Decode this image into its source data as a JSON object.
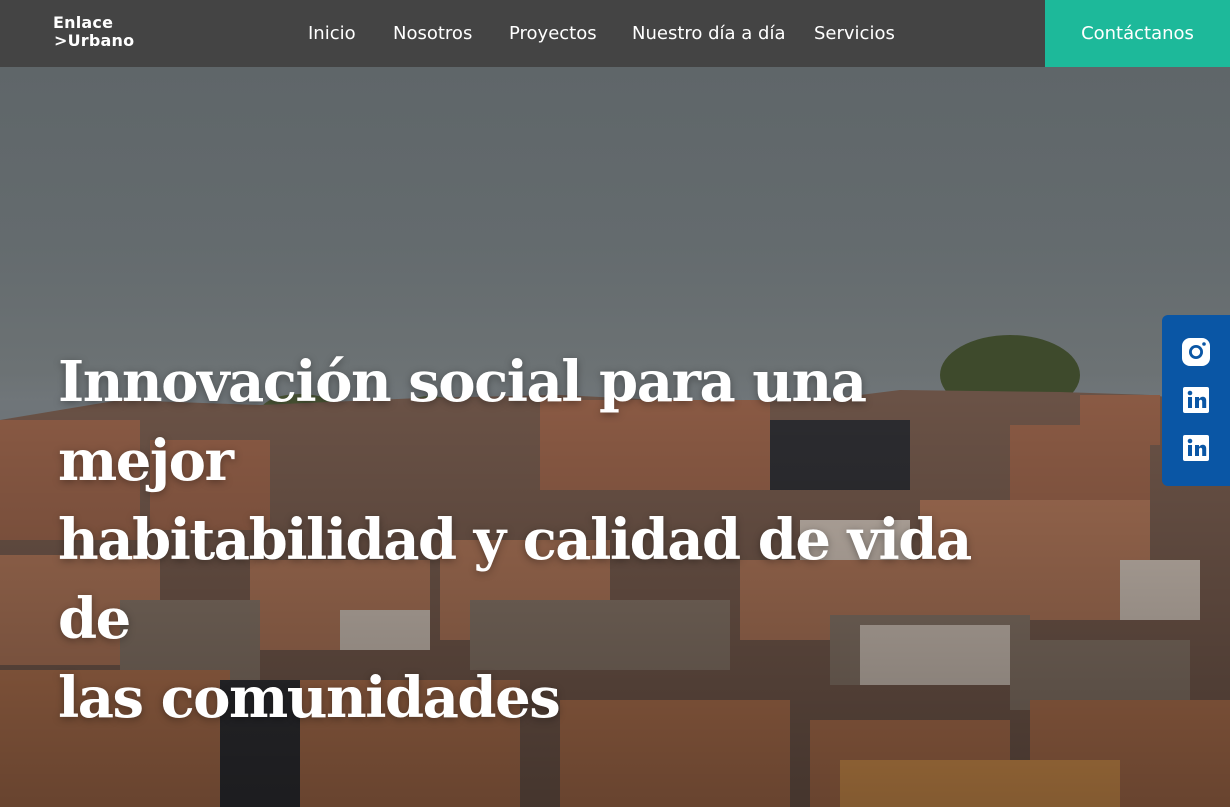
{
  "brand": {
    "logo_line1": "Enlace",
    "logo_line2": ">Urbano"
  },
  "nav": {
    "items": [
      {
        "label": "Inicio"
      },
      {
        "label": "Nosotros"
      },
      {
        "label": "Proyectos"
      },
      {
        "label": "Nuestro día a día"
      },
      {
        "label": "Servicios"
      }
    ],
    "cta_label": "Contáctanos"
  },
  "hero": {
    "headline_line1": "Innovación social para una mejor",
    "headline_line2": "habitabilidad y calidad de vida de",
    "headline_line3": "las comunidades",
    "background": "hillside-neighborhood-photo"
  },
  "social": {
    "items": [
      {
        "icon": "instagram-icon"
      },
      {
        "icon": "linkedin-icon"
      },
      {
        "icon": "linkedin-icon"
      }
    ]
  },
  "colors": {
    "navbar": "#444444",
    "accent": "#1db99a",
    "social_bar": "#0a56a5",
    "text": "#ffffff"
  }
}
